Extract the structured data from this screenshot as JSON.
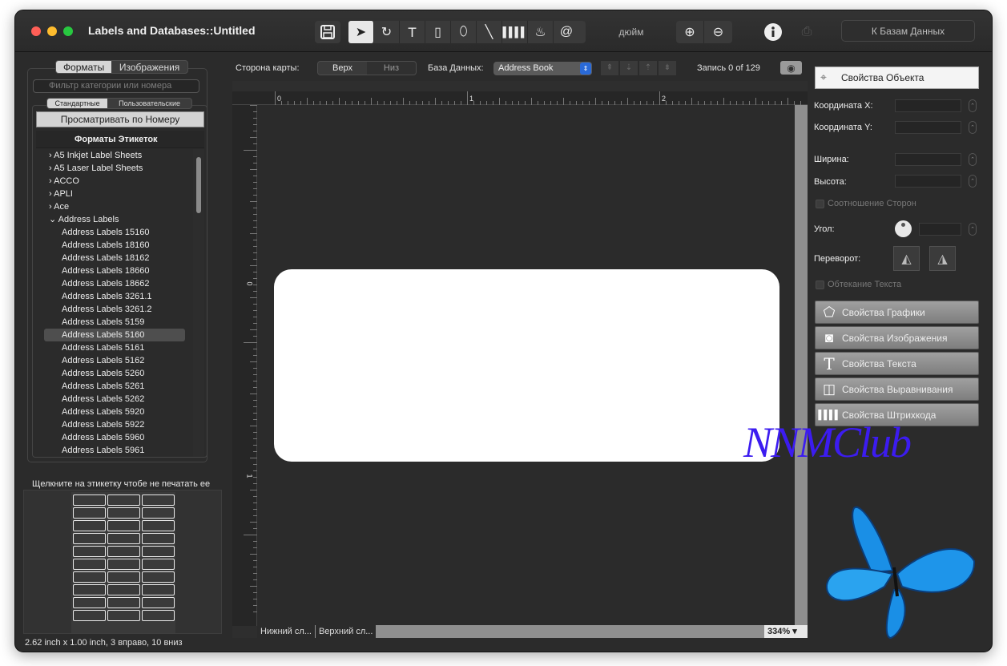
{
  "window": {
    "title": "Labels and  Databases::Untitled",
    "lights": {
      "close": "#ff5f57",
      "minimize": "#febc2e",
      "zoom": "#28c840"
    }
  },
  "toolbar": {
    "units_label": "дюйм",
    "to_databases_button": "К Базам Данных",
    "tools": [
      "save-icon",
      "arrow-icon",
      "rotate-icon",
      "text-icon",
      "rectangle-icon",
      "ellipse-icon",
      "line-icon",
      "barcode-icon",
      "image-icon",
      "at-icon"
    ]
  },
  "left_panel": {
    "tabs": [
      "Форматы",
      "Изображения"
    ],
    "active_tab": "Форматы",
    "search_placeholder": "Фильтр категории или номера",
    "subtabs": [
      "Стандартные",
      "Пользовательские"
    ],
    "active_subtab": "Стандартные",
    "browse_button": "Просматривать по Номеру",
    "list_header": "Форматы Этикеток",
    "items": [
      {
        "label": "A5 Inkjet Label Sheets",
        "level": 0,
        "expanded": false
      },
      {
        "label": "A5 Laser Label Sheets",
        "level": 0,
        "expanded": false
      },
      {
        "label": "ACCO",
        "level": 0,
        "expanded": false
      },
      {
        "label": "APLI",
        "level": 0,
        "expanded": false
      },
      {
        "label": "Ace",
        "level": 0,
        "expanded": false
      },
      {
        "label": "Address Labels",
        "level": 0,
        "expanded": true
      },
      {
        "label": "Address Labels 15160",
        "level": 1
      },
      {
        "label": "Address Labels 18160",
        "level": 1
      },
      {
        "label": "Address Labels 18162",
        "level": 1
      },
      {
        "label": "Address Labels 18660",
        "level": 1
      },
      {
        "label": "Address Labels 18662",
        "level": 1
      },
      {
        "label": "Address Labels 3261.1",
        "level": 1
      },
      {
        "label": "Address Labels 3261.2",
        "level": 1
      },
      {
        "label": "Address Labels 5159",
        "level": 1
      },
      {
        "label": "Address Labels 5160",
        "level": 1,
        "selected": true
      },
      {
        "label": "Address Labels 5161",
        "level": 1
      },
      {
        "label": "Address Labels 5162",
        "level": 1
      },
      {
        "label": "Address Labels 5260",
        "level": 1
      },
      {
        "label": "Address Labels 5261",
        "level": 1
      },
      {
        "label": "Address Labels 5262",
        "level": 1
      },
      {
        "label": "Address Labels 5920",
        "level": 1
      },
      {
        "label": "Address Labels 5922",
        "level": 1
      },
      {
        "label": "Address Labels 5960",
        "level": 1
      },
      {
        "label": "Address Labels 5961",
        "level": 1
      }
    ],
    "click_note": "Щелкните на этикетку чтобе не печатать ее",
    "sheet": {
      "columns": 3,
      "rows": 10
    },
    "status": "2.62 inch x 1.00 inch, 3 вправо, 10 вниз"
  },
  "canvas": {
    "side_label": "Сторона карты:",
    "side_options": [
      "Верх",
      "Низ"
    ],
    "active_side": "Верх",
    "db_label": "База Данных:",
    "db_value": "Address Book",
    "record": "Запись 0 of 129",
    "ruler_h": [
      "0",
      "1",
      "2"
    ],
    "ruler_v": [
      "0",
      "1"
    ],
    "layers": [
      "Нижний сл...",
      "Верхний сл..."
    ],
    "zoom": "334% ▾"
  },
  "right_panel": {
    "object_props": "Свойства Объекта",
    "coord_x": "Координата X:",
    "coord_y": "Координата Y:",
    "width": "Ширина:",
    "height": "Высота:",
    "aspect": "Соотношение Сторон",
    "angle": "Угол:",
    "flip": "Переворот:",
    "wrap": "Обтекание Текста",
    "buttons": [
      {
        "label": "Свойства Графики",
        "icon": "shapes-icon"
      },
      {
        "label": "Свойства Изображения",
        "icon": "camera-icon"
      },
      {
        "label": "Свойства Текста",
        "icon": "text-icon"
      },
      {
        "label": "Свойства Выравнивания",
        "icon": "align-icon"
      },
      {
        "label": "Свойства Штрихкода",
        "icon": "barcode-icon"
      }
    ]
  },
  "watermark": "NNMClub"
}
